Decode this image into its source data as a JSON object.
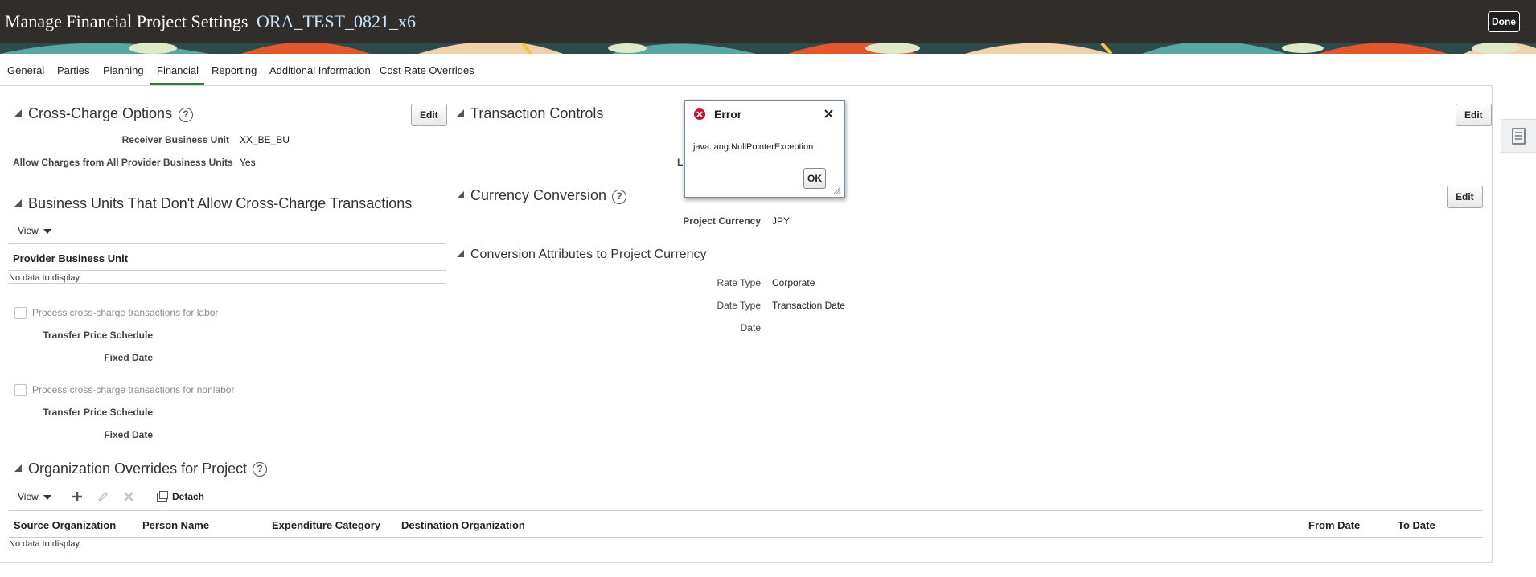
{
  "header": {
    "title": "Manage Financial Project Settings",
    "project_name": "ORA_TEST_0821_x6",
    "done_label": "Done"
  },
  "tabs": [
    {
      "label": "General"
    },
    {
      "label": "Parties"
    },
    {
      "label": "Planning"
    },
    {
      "label": "Financial",
      "selected": true
    },
    {
      "label": "Reporting"
    },
    {
      "label": "Additional Information"
    },
    {
      "label": "Cost Rate Overrides"
    }
  ],
  "cross_charge": {
    "title": "Cross-Charge Options",
    "edit_label": "Edit",
    "receiver_bu_label": "Receiver Business Unit",
    "receiver_bu_value": "XX_BE_BU",
    "allow_charges_label": "Allow Charges from All Provider Business Units",
    "allow_charges_value": "Yes"
  },
  "bu_no_cross_charge": {
    "title": "Business Units That Don't Allow Cross-Charge Transactions",
    "view_label": "View",
    "column_header": "Provider Business Unit",
    "no_data": "No data to display."
  },
  "labor": {
    "checkbox_label": "Process cross-charge transactions for labor",
    "transfer_price_label": "Transfer Price Schedule",
    "fixed_date_label": "Fixed Date"
  },
  "nonlabor": {
    "checkbox_label": "Process cross-charge transactions for nonlabor",
    "transfer_price_label": "Transfer Price Schedule",
    "fixed_date_label": "Fixed Date"
  },
  "org_overrides": {
    "title": "Organization Overrides for Project",
    "view_label": "View",
    "detach_label": "Detach",
    "columns": [
      "Source Organization",
      "Person Name",
      "Expenditure Category",
      "Destination Organization",
      "From Date",
      "To Date"
    ],
    "no_data": "No data to display."
  },
  "transaction_controls": {
    "title": "Transaction Controls",
    "edit_label": "Edit",
    "partial_label": "L"
  },
  "currency_conversion": {
    "title": "Currency Conversion",
    "edit_label": "Edit",
    "project_currency_label": "Project Currency",
    "project_currency_value": "JPY"
  },
  "conversion_attributes": {
    "title": "Conversion Attributes to Project Currency",
    "rate_type_label": "Rate Type",
    "rate_type_value": "Corporate",
    "date_type_label": "Date Type",
    "date_type_value": "Transaction Date",
    "date_label": "Date"
  },
  "error_dialog": {
    "title": "Error",
    "message": "java.lang.NullPointerException",
    "ok_label": "OK"
  },
  "colors": {
    "header_bg": "#312d2a",
    "tab_selected_underline": "#2e7d32",
    "error_icon": "#c8102e"
  }
}
